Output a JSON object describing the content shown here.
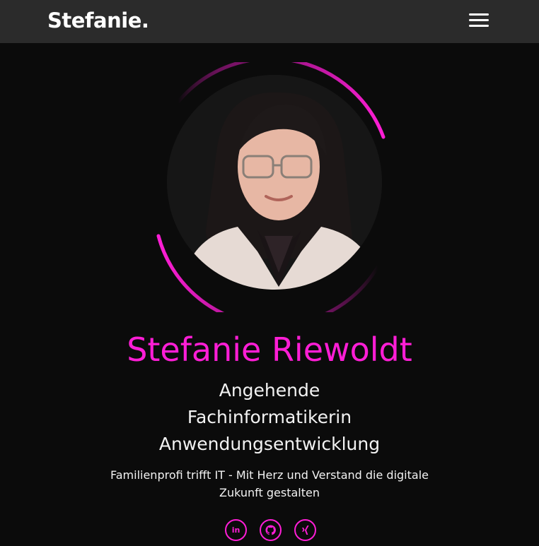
{
  "navbar": {
    "brand": "Stefanie.",
    "menu_icon": "hamburger-menu-icon"
  },
  "hero": {
    "name": "Stefanie Riewoldt",
    "role_lines": [
      "Angehende",
      "Fachinformatikerin",
      "Anwendungsentwicklung"
    ],
    "tagline": "Familienprofi trifft IT - Mit Herz und Verstand die digitale Zukunft gestalten",
    "accent_color": "#ff1ed6"
  },
  "social": [
    {
      "icon": "linkedin-icon",
      "label": "in"
    },
    {
      "icon": "github-icon"
    },
    {
      "icon": "xing-icon"
    }
  ]
}
